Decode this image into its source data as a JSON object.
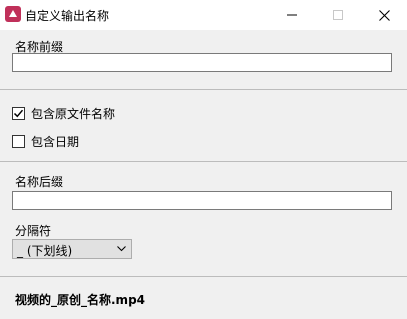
{
  "window": {
    "title": "自定义输出名称",
    "app_icon": "app-icon",
    "controls": [
      "minimize-icon",
      "maximize-icon",
      "close-icon"
    ]
  },
  "prefix": {
    "label": "名称前缀",
    "value": ""
  },
  "include_original": {
    "label": "包含原文件名称",
    "checked": true
  },
  "include_date": {
    "label": "包含日期",
    "checked": false
  },
  "suffix": {
    "label": "名称后缀",
    "value": ""
  },
  "separator": {
    "label": "分隔符",
    "selected": "_ (下划线)"
  },
  "preview": {
    "text": "视频的_原创_名称.mp4"
  }
}
